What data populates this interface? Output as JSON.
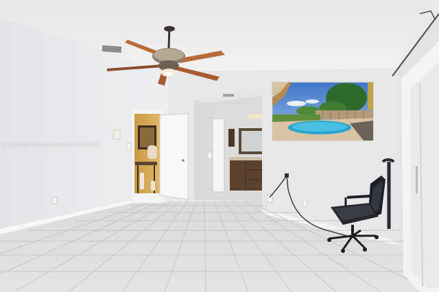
{
  "photo": {
    "watermark": "A11532478 ©2025 Miami MLS MATRIX"
  }
}
